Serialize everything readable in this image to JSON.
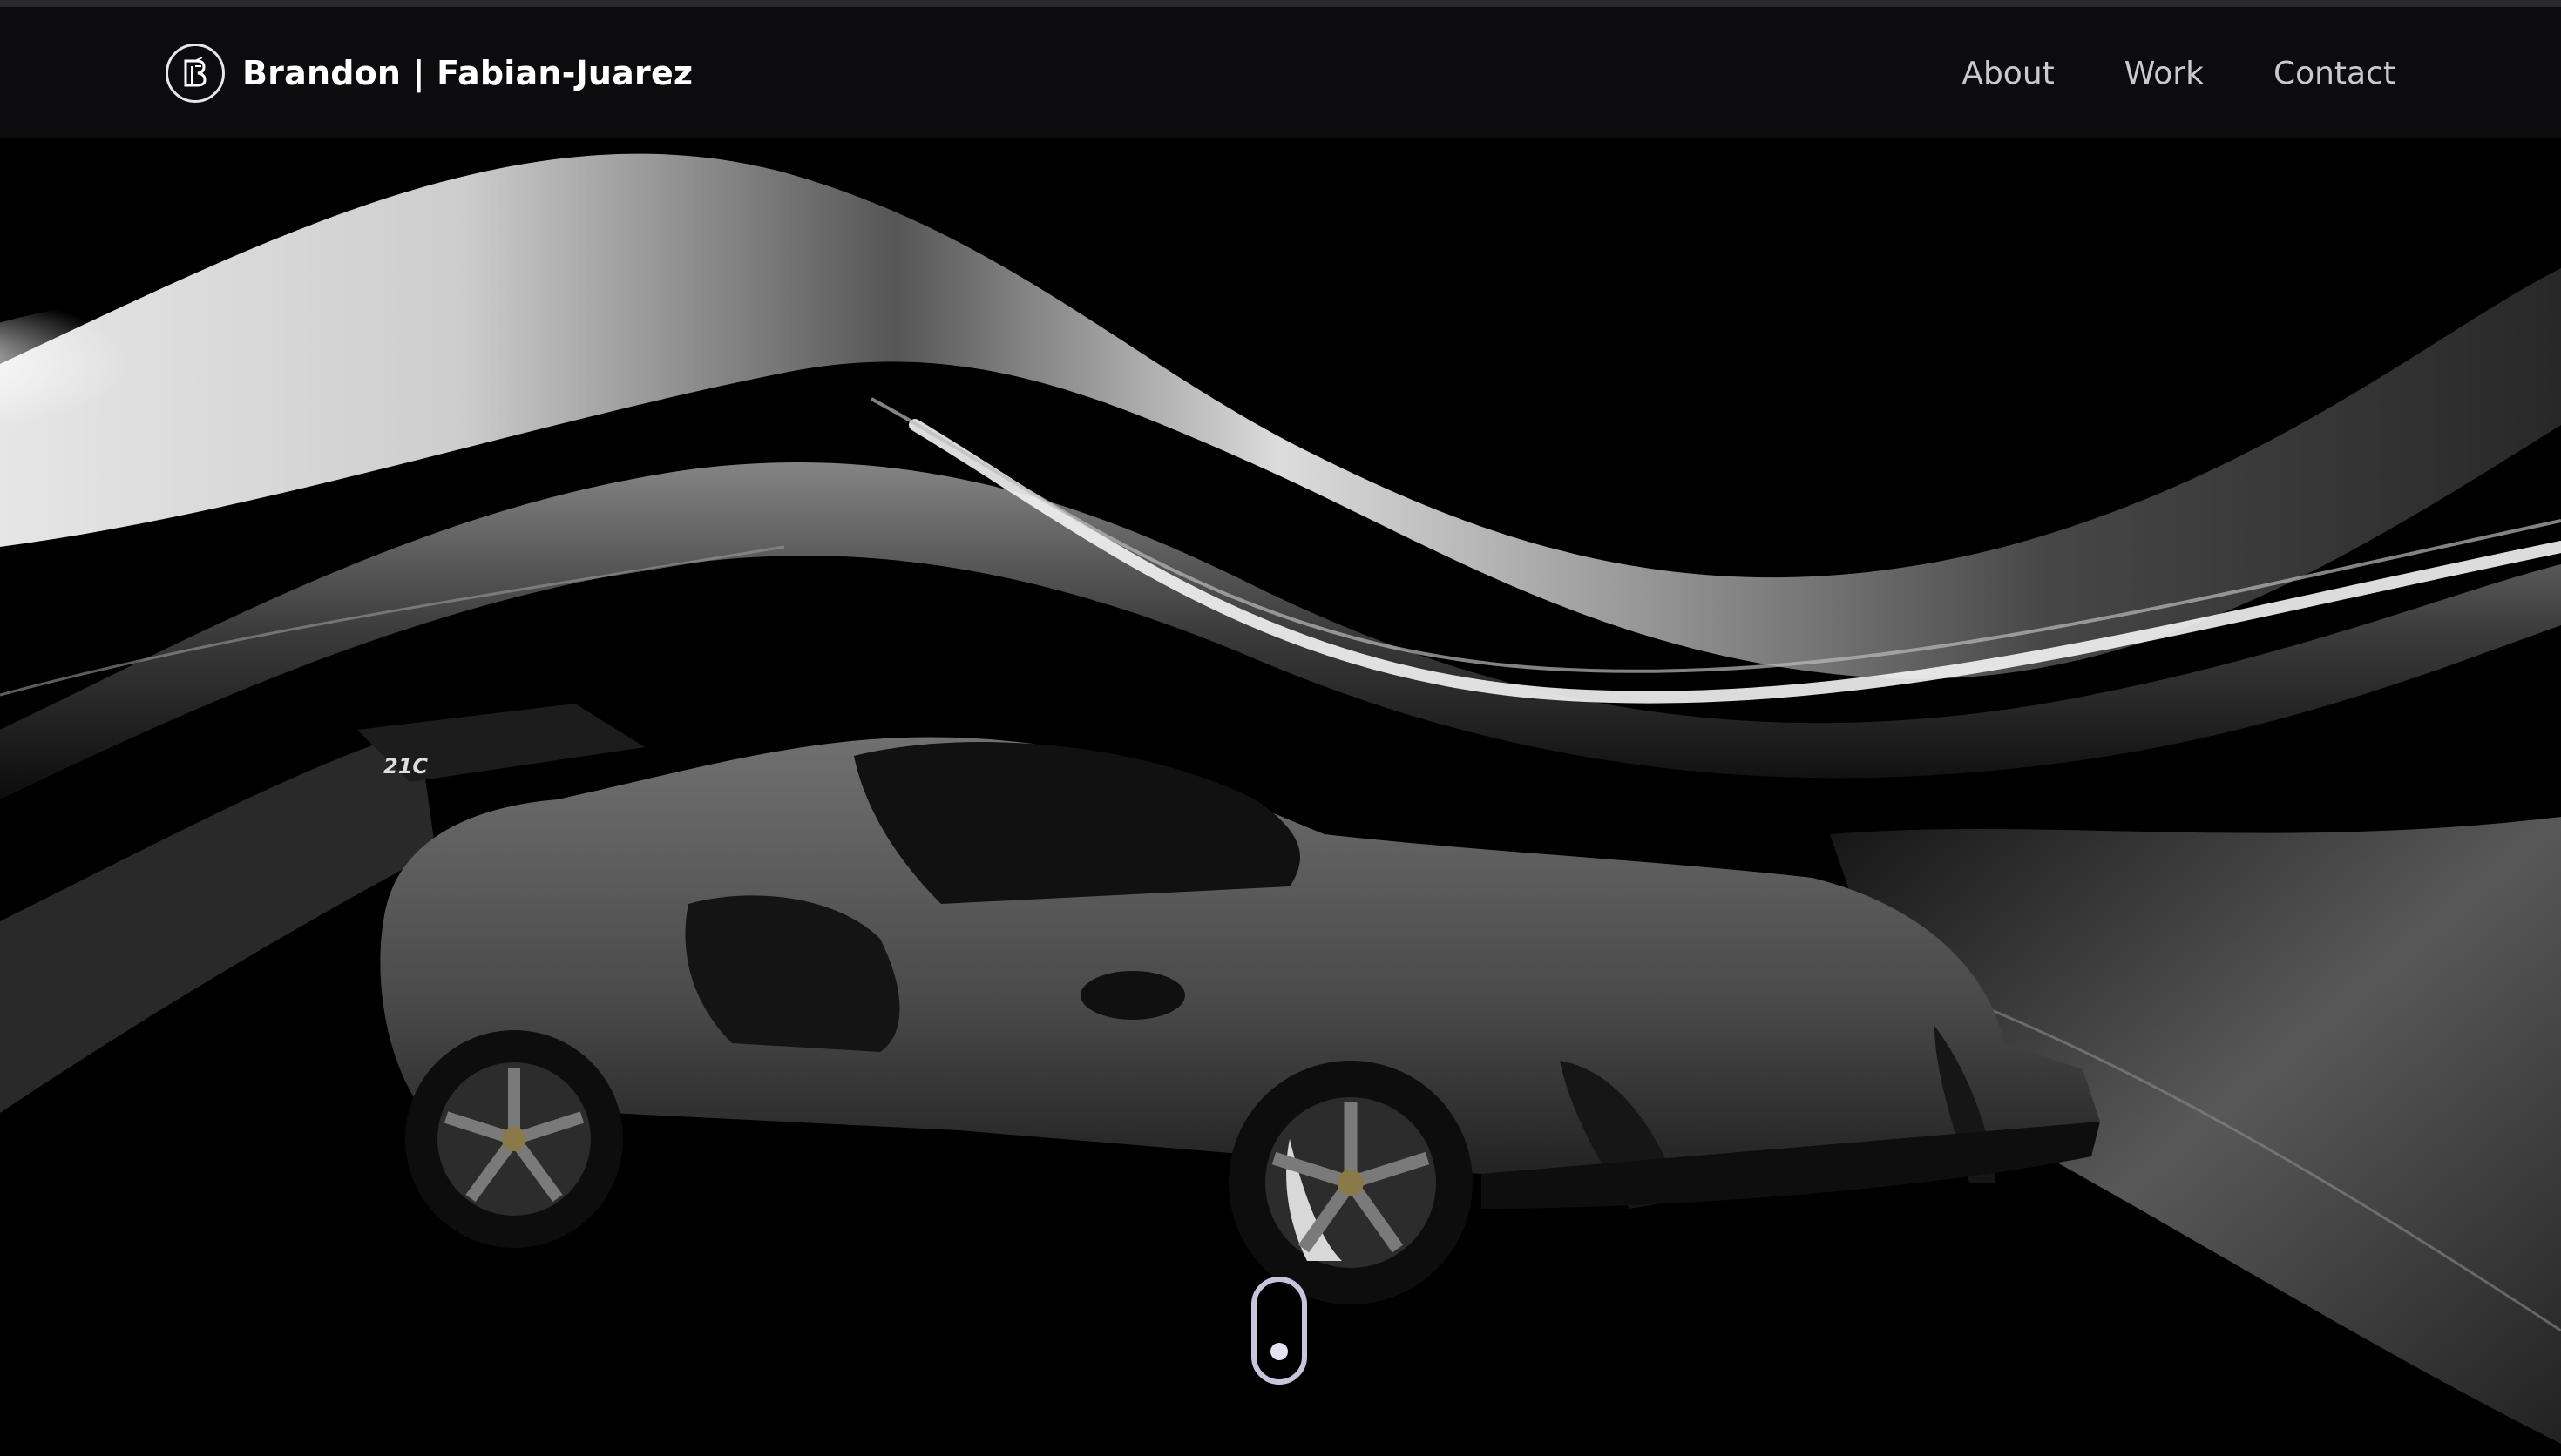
{
  "header": {
    "brand_name": "Brandon | Fabian-Juarez",
    "logo_icon": "bf-monogram-icon"
  },
  "nav": {
    "items": [
      {
        "label": "About"
      },
      {
        "label": "Work"
      },
      {
        "label": "Contact"
      }
    ]
  },
  "hero": {
    "background_image": "silver-silk-waves-with-dark-sports-car",
    "car_badge": "21C",
    "scroll_icon": "mouse-scroll-icon"
  },
  "colors": {
    "background": "#000000",
    "navbar": "#0c0c0e",
    "nav_link": "#c9c9cf",
    "brand_text": "#ffffff",
    "scroll_indicator": "#c7c4dc"
  }
}
